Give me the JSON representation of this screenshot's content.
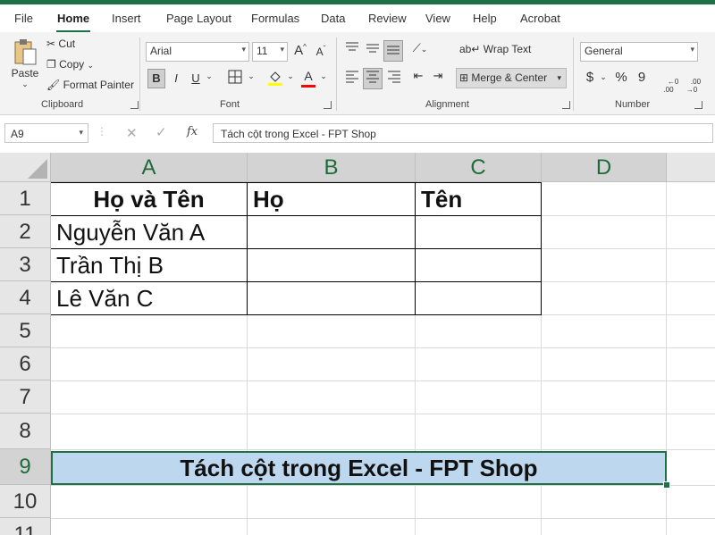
{
  "menu": {
    "tabs": [
      "File",
      "Home",
      "Insert",
      "Page Layout",
      "Formulas",
      "Data",
      "Review",
      "View",
      "Help",
      "Acrobat"
    ]
  },
  "ribbon": {
    "clipboard": {
      "paste": "Paste",
      "cut": "Cut",
      "copy": "Copy",
      "format_painter": "Format Painter",
      "label": "Clipboard"
    },
    "font": {
      "name": "Arial",
      "size": "11",
      "grow": "A",
      "shrink": "A",
      "bold": "B",
      "italic": "I",
      "underline": "U",
      "label": "Font",
      "font_color_letter": "A"
    },
    "alignment": {
      "wrap_text": "Wrap Text",
      "merge_center": "Merge & Center",
      "label": "Alignment"
    },
    "number": {
      "format": "General",
      "currency": "$",
      "percent": "%",
      "comma": "9",
      "inc_decimal": "←0\n.00",
      "dec_decimal": ".00\n→0",
      "label": "Number"
    }
  },
  "formula_bar": {
    "name_box": "A9",
    "fx": "fx",
    "value": "Tách cột trong Excel - FPT Shop"
  },
  "columns": [
    "A",
    "B",
    "C",
    "D"
  ],
  "rows": [
    "1",
    "2",
    "3",
    "4",
    "5",
    "6",
    "7",
    "8",
    "9",
    "10",
    "11"
  ],
  "cells": {
    "A1": "Họ và Tên",
    "B1": "Họ",
    "C1": "Tên",
    "A2": "Nguyễn Văn A",
    "A3": "Trần Thị B",
    "A4": "Lê Văn C",
    "A9": "Tách cột trong Excel - FPT Shop"
  },
  "colors": {
    "accent": "#1e7145",
    "merged_fill": "#bdd7ee",
    "font_color_bar": "#ff0000",
    "fill_color_bar": "#ffff00"
  }
}
